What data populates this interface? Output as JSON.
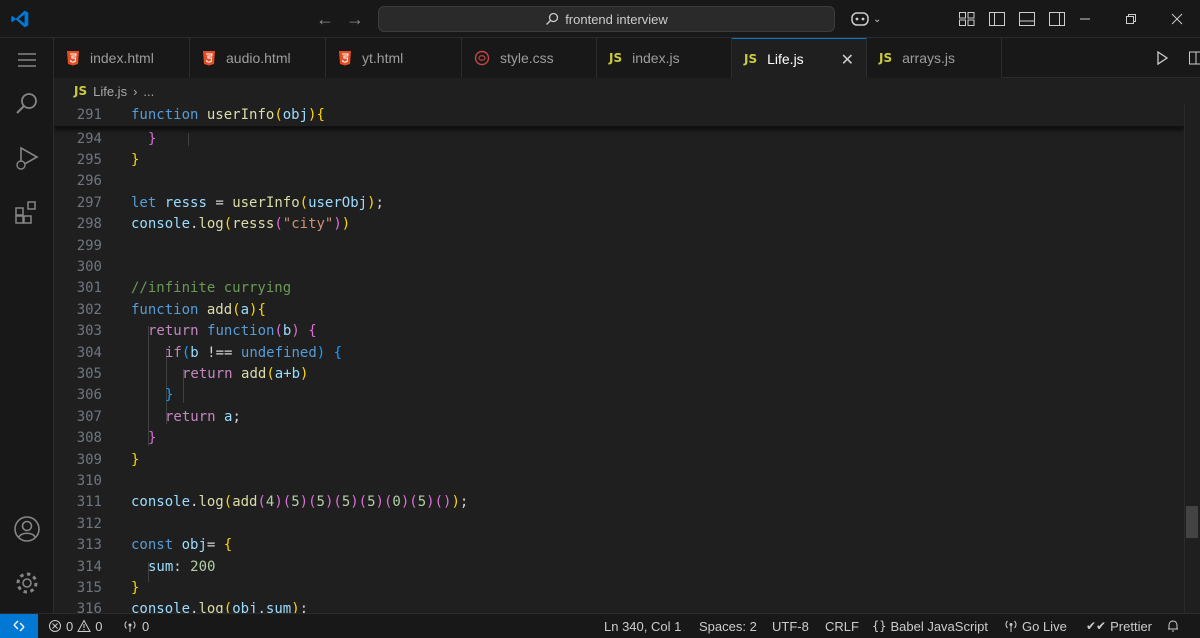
{
  "titlebar": {
    "search_text": "frontend interview",
    "icons": [
      "vscode-logo",
      "back-arrow-icon",
      "forward-arrow-icon",
      "search-icon",
      "copilot-icon",
      "customize-layout-icon",
      "toggle-primary-sidebar-icon",
      "toggle-panel-icon",
      "toggle-secondary-sidebar-icon",
      "minimize-icon",
      "restore-icon",
      "close-icon"
    ]
  },
  "activitybar": [
    "explorer-icon",
    "search-icon",
    "run-debug-icon",
    "extensions-icon",
    "accounts-icon",
    "manage-gear-icon"
  ],
  "tabs": [
    {
      "label": "index.html",
      "type": "html"
    },
    {
      "label": "audio.html",
      "type": "html"
    },
    {
      "label": "yt.html",
      "type": "html"
    },
    {
      "label": "style.css",
      "type": "css"
    },
    {
      "label": "index.js",
      "type": "js"
    },
    {
      "label": "Life.js",
      "type": "js",
      "active": true
    },
    {
      "label": "arrays.js",
      "type": "js"
    }
  ],
  "js_badge": "JS",
  "breadcrumb": {
    "file": "Life.js",
    "rest": "..."
  },
  "sticky_line": {
    "num": "291"
  },
  "line_numbers": [
    "294",
    "295",
    "296",
    "297",
    "298",
    "299",
    "300",
    "301",
    "302",
    "303",
    "304",
    "305",
    "306",
    "307",
    "308",
    "309",
    "310",
    "311",
    "312",
    "313",
    "314",
    "315",
    "316"
  ],
  "code": {
    "sticky": {
      "kw": "function",
      "name": "userInfo",
      "param": "obj"
    },
    "l294": "}",
    "l295": "}",
    "l297": {
      "kw": "let",
      "var": "resss",
      "fn": "userInfo",
      "arg": "userObj"
    },
    "l298": {
      "obj": "console",
      "fn": "log",
      "inner": "resss",
      "str": "\"city\""
    },
    "l301": "//infinite currying",
    "l302": {
      "kw": "function",
      "name": "add",
      "param": "a"
    },
    "l303": {
      "kw": "return",
      "kw2": "function",
      "param": "b"
    },
    "l304": {
      "kw": "if",
      "var": "b",
      "op": " !== ",
      "undef": "undefined"
    },
    "l305": {
      "kw": "return",
      "fn": "add",
      "args": "a+b"
    },
    "l307": {
      "kw": "return",
      "var": "a"
    },
    "l311": {
      "obj": "console",
      "fn": "log",
      "call": "add",
      "args": [
        "4",
        "5",
        "5",
        "5",
        "5",
        "0",
        "5"
      ]
    },
    "l313": {
      "kw": "const",
      "var": "obj"
    },
    "l314": {
      "prop": "sum",
      "num": "200"
    },
    "l316": {
      "obj": "console",
      "fn": "log",
      "arg": "obj.sum"
    }
  },
  "statusbar": {
    "errors": "0",
    "warnings": "0",
    "ports": "0",
    "position": "Ln 340, Col 1",
    "spaces": "Spaces: 2",
    "encoding": "UTF-8",
    "eol": "CRLF",
    "language": "Babel JavaScript",
    "golive": "Go Live",
    "prettier": "Prettier"
  },
  "colors": {
    "accent": "#0078d4",
    "background": "#1f1f1f",
    "chrome": "#181818"
  }
}
